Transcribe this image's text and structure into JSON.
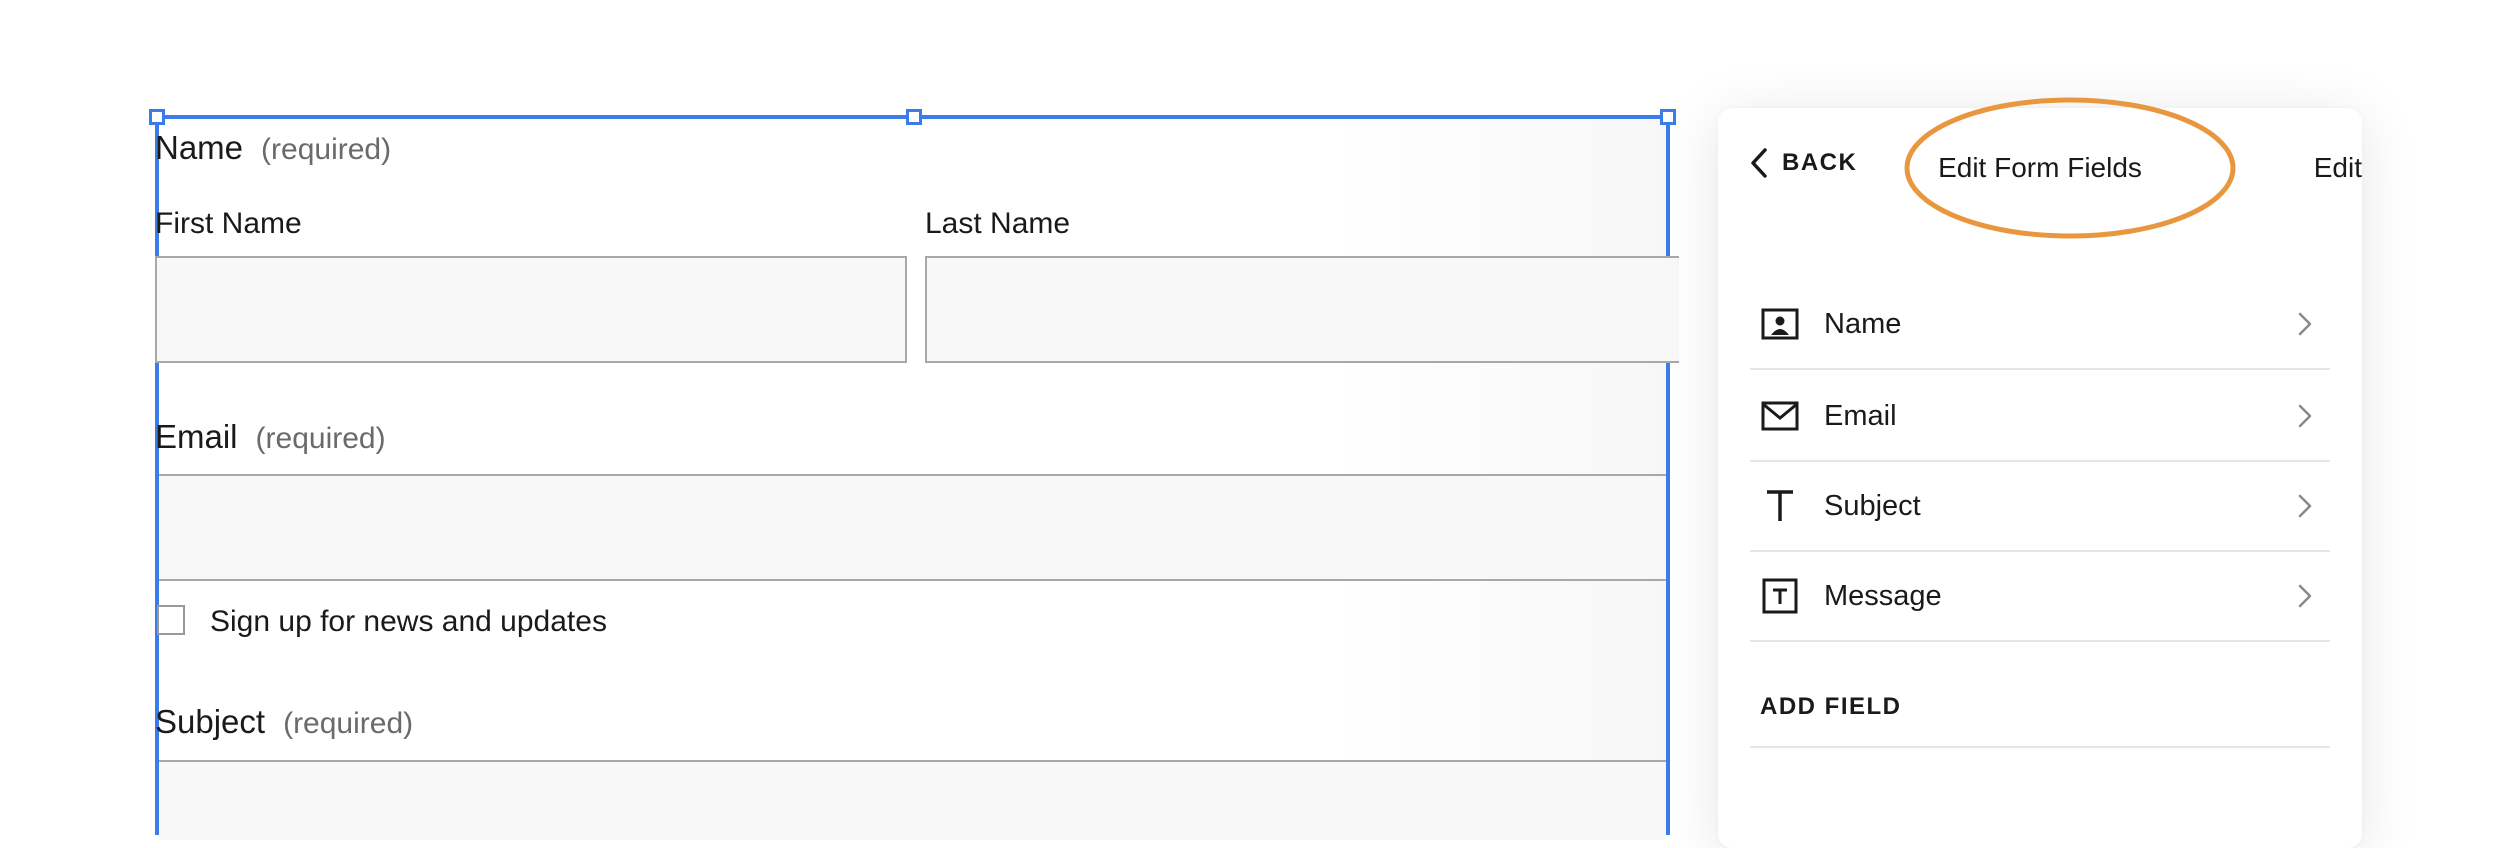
{
  "form": {
    "name_field": {
      "label": "Name",
      "required_note": "(required)",
      "first_name_label": "First Name",
      "last_name_label": "Last Name",
      "first_name_value": "",
      "last_name_value": ""
    },
    "email_field": {
      "label": "Email",
      "required_note": "(required)",
      "value": ""
    },
    "newsletter_checkbox": {
      "label": "Sign up for news and updates",
      "checked": false
    },
    "subject_field": {
      "label": "Subject",
      "required_note": "(required)",
      "value": ""
    }
  },
  "panel": {
    "back_label": "BACK",
    "title": "Edit Form Fields",
    "edit_label": "Edit",
    "fields": [
      {
        "label": "Name",
        "icon": "contact-card-icon"
      },
      {
        "label": "Email",
        "icon": "envelope-icon"
      },
      {
        "label": "Subject",
        "icon": "text-t-icon"
      },
      {
        "label": "Message",
        "icon": "text-box-icon"
      }
    ],
    "add_field_label": "ADD FIELD"
  },
  "colors": {
    "selection_blue": "#3b7de8",
    "highlight_orange": "#e8973e",
    "input_background": "#f8f8f8",
    "input_border": "#a8a8a8"
  }
}
